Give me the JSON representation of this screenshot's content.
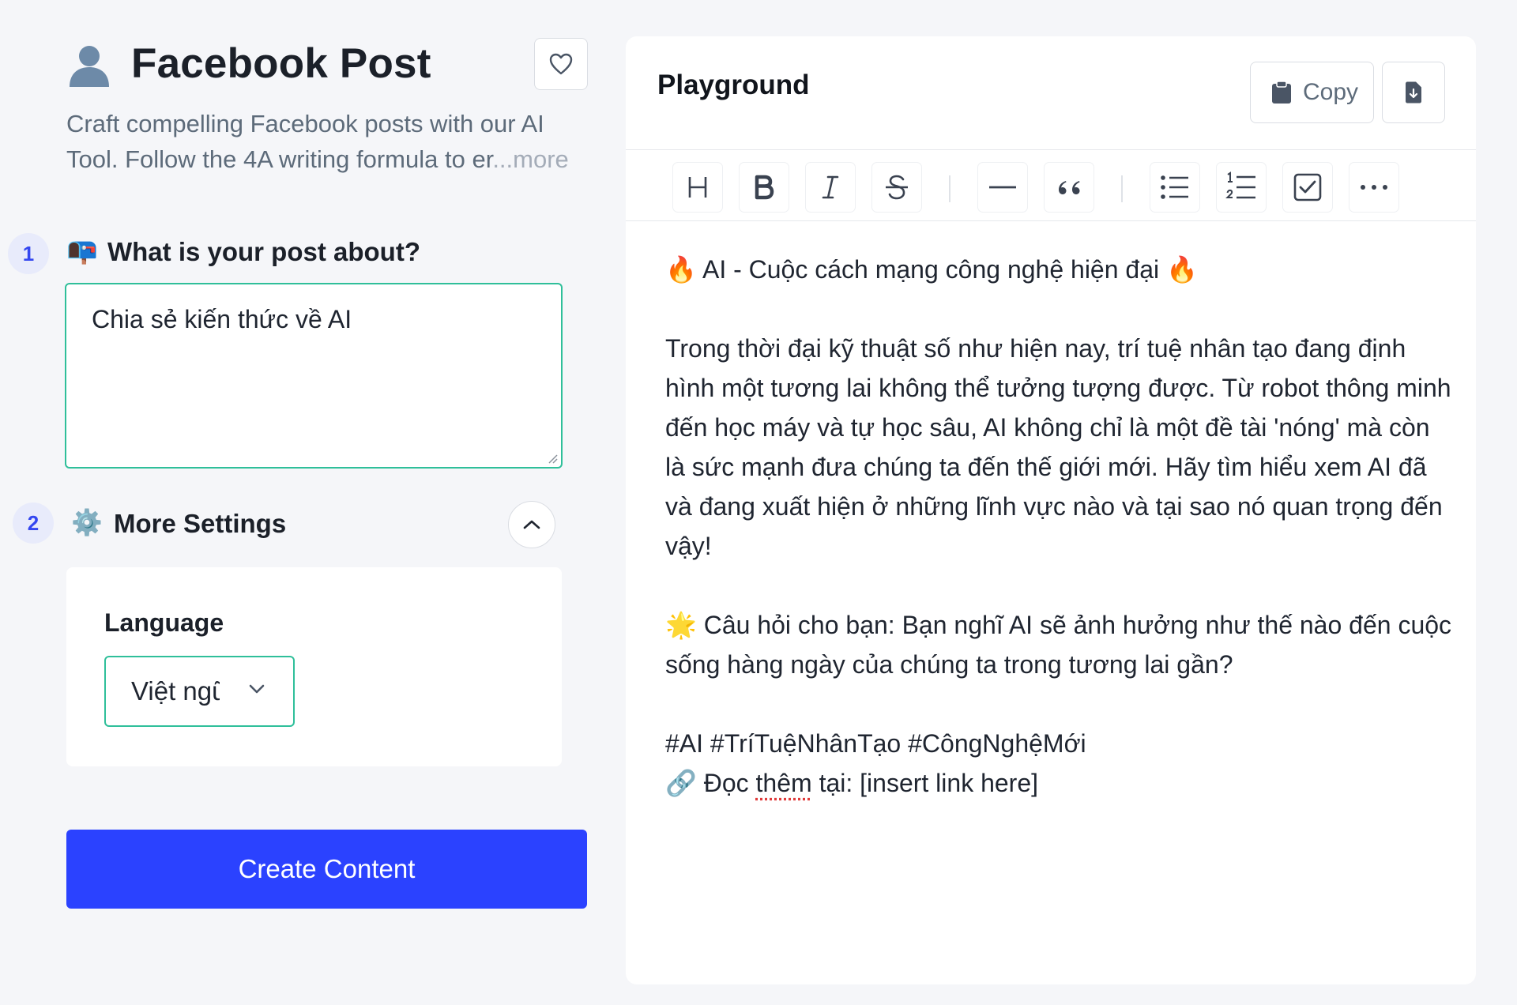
{
  "tool": {
    "title": "Facebook Post",
    "description": "Craft compelling Facebook posts with our AI Tool. Follow the 4A writing formula to er",
    "more_label": "...more"
  },
  "step1": {
    "number": "1",
    "emoji": "📭",
    "label": "What is your post about?",
    "value": "Chia sẻ kiến thức về AI"
  },
  "step2": {
    "number": "2",
    "emoji": "⚙️",
    "label": "More Settings",
    "language_label": "Language",
    "language_value": "Việt ngữ"
  },
  "create_button": "Create Content",
  "playground": {
    "title": "Playground",
    "copy_label": "Copy",
    "toolbar": [
      {
        "name": "heading-button",
        "icon": "H"
      },
      {
        "name": "bold-button",
        "icon": "bold"
      },
      {
        "name": "italic-button",
        "icon": "italic"
      },
      {
        "name": "strikethrough-button",
        "icon": "strike"
      },
      {
        "name": "horizontal-rule-button",
        "icon": "hr"
      },
      {
        "name": "quote-button",
        "icon": "66"
      },
      {
        "name": "bullet-list-button",
        "icon": "bullets"
      },
      {
        "name": "numbered-list-button",
        "icon": "numbers"
      },
      {
        "name": "checklist-button",
        "icon": "check"
      },
      {
        "name": "more-button",
        "icon": "dots"
      }
    ],
    "content": {
      "heading": "🔥 AI - Cuộc cách mạng công nghệ hiện đại 🔥",
      "paragraph": "Trong thời đại kỹ thuật số như hiện nay, trí tuệ nhân tạo đang định hình một tương lai không thể tưởng tượng được. Từ robot thông minh đến học máy và tự học sâu, AI không chỉ là một đề tài 'nóng' mà còn là sức mạnh đưa chúng ta đến thế giới mới. Hãy tìm hiểu xem AI đã và đang xuất hiện ở những lĩnh vực nào và tại sao nó quan trọng đến vậy!",
      "question": "🌟 Câu hỏi cho bạn: Bạn nghĩ AI sẽ ảnh hưởng như thế nào đến cuộc sống hàng ngày của chúng ta trong tương lai gần?",
      "hashtags": "#AI #TríTuệNhânTạo #CôngNghệMới",
      "link_prefix": "🔗 Đọc ",
      "link_spell": "thêm",
      "link_suffix": " tại: [insert link here]"
    }
  }
}
